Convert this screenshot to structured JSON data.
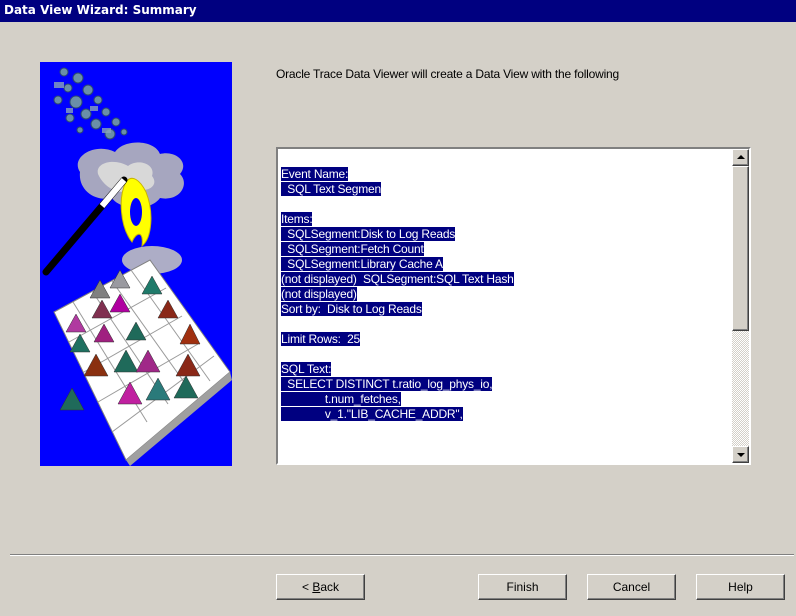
{
  "window": {
    "title": "Data View Wizard:  Summary"
  },
  "description": "Oracle Trace Data Viewer will create a Data View with the following",
  "summary_lines": [
    {
      "text": "Event Name:",
      "hl": true
    },
    {
      "text": "  SQL Text Segmen",
      "hl": true
    },
    {
      "text": "",
      "hl": false
    },
    {
      "text": "Items:",
      "hl": true
    },
    {
      "text": "  SQLSegment:Disk to Log Reads",
      "hl": true
    },
    {
      "text": "  SQLSegment:Fetch Count",
      "hl": true
    },
    {
      "text": "  SQLSegment:Library Cache A",
      "hl": true
    },
    {
      "text": "(not displayed)  SQLSegment:SQL Text Hash",
      "hl": true
    },
    {
      "text": "(not displayed)",
      "hl": true
    },
    {
      "text": "Sort by:  Disk to Log Reads",
      "hl": true
    },
    {
      "text": "",
      "hl": false
    },
    {
      "text": "Limit Rows:  25",
      "hl": true
    },
    {
      "text": "",
      "hl": false
    },
    {
      "text": "SQL Text:",
      "hl": true
    },
    {
      "text": "  SELECT DISTINCT t.ratio_log_phys_io,",
      "hl": true
    },
    {
      "text": "              t.num_fetches,",
      "hl": true
    },
    {
      "text": "              v_1.\"LIB_CACHE_ADDR\",",
      "hl": true
    }
  ],
  "buttons": {
    "back_prefix": "< ",
    "back_accel": "B",
    "back_rest": "ack",
    "finish": "Finish",
    "cancel": "Cancel",
    "help": "Help"
  },
  "colors": {
    "title_bar": "#000080",
    "selection": "#000080",
    "artwork_background": "#0000ff",
    "dialog_face": "#d4d0c8"
  },
  "icons": {
    "scroll_up": "triangle-up",
    "scroll_down": "triangle-down"
  }
}
